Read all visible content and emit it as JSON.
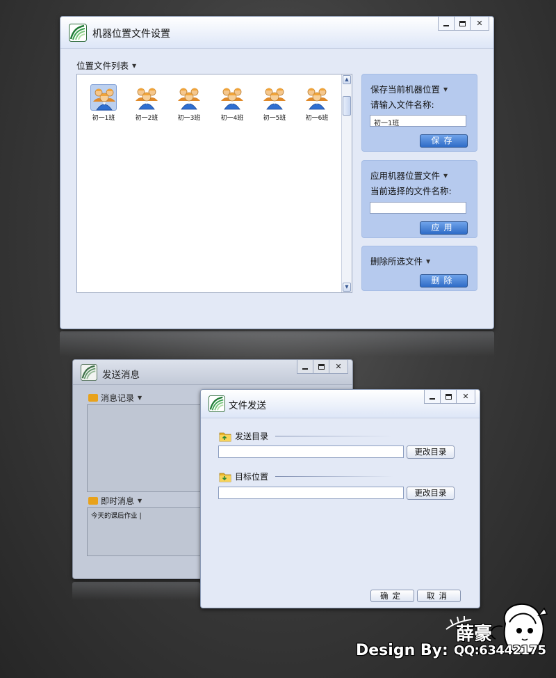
{
  "colors": {
    "accent_blue": "#2f6cc7",
    "panel_blue": "#b6caee",
    "window_bg": "#e3e9f6"
  },
  "window_controls": {
    "minimize": "–",
    "maximize": "□",
    "close": "✕"
  },
  "positions_window": {
    "title": "机器位置文件设置",
    "list_label": "位置文件列表",
    "icon_name": "class-group-icon",
    "items": [
      {
        "label": "初一1班",
        "selected": true
      },
      {
        "label": "初一2班",
        "selected": false
      },
      {
        "label": "初一3班",
        "selected": false
      },
      {
        "label": "初一4班",
        "selected": false
      },
      {
        "label": "初一5班",
        "selected": false
      },
      {
        "label": "初一6班",
        "selected": false
      }
    ],
    "save_panel": {
      "title": "保存当前机器位置",
      "prompt": "请输入文件名称:",
      "input_value": "初一1班",
      "button": "保存"
    },
    "apply_panel": {
      "title": "应用机器位置文件",
      "prompt": "当前选择的文件名称:",
      "input_value": "",
      "button": "应用"
    },
    "delete_panel": {
      "title": "删除所选文件",
      "button": "删除"
    }
  },
  "send_message_window": {
    "title": "发送消息",
    "history_label": "消息记录",
    "instant_label": "即时消息",
    "draft_text": "今天的课后作业 |"
  },
  "file_send_window": {
    "title": "文件发送",
    "source_label": "发送目录",
    "source_value": "",
    "target_label": "目标位置",
    "target_value": "",
    "change_button": "更改目录",
    "ok_button": "确定",
    "cancel_button": "取消"
  },
  "signature": {
    "design_by": "Design By:",
    "name": "薛豪",
    "qq": "QQ:63442175"
  }
}
